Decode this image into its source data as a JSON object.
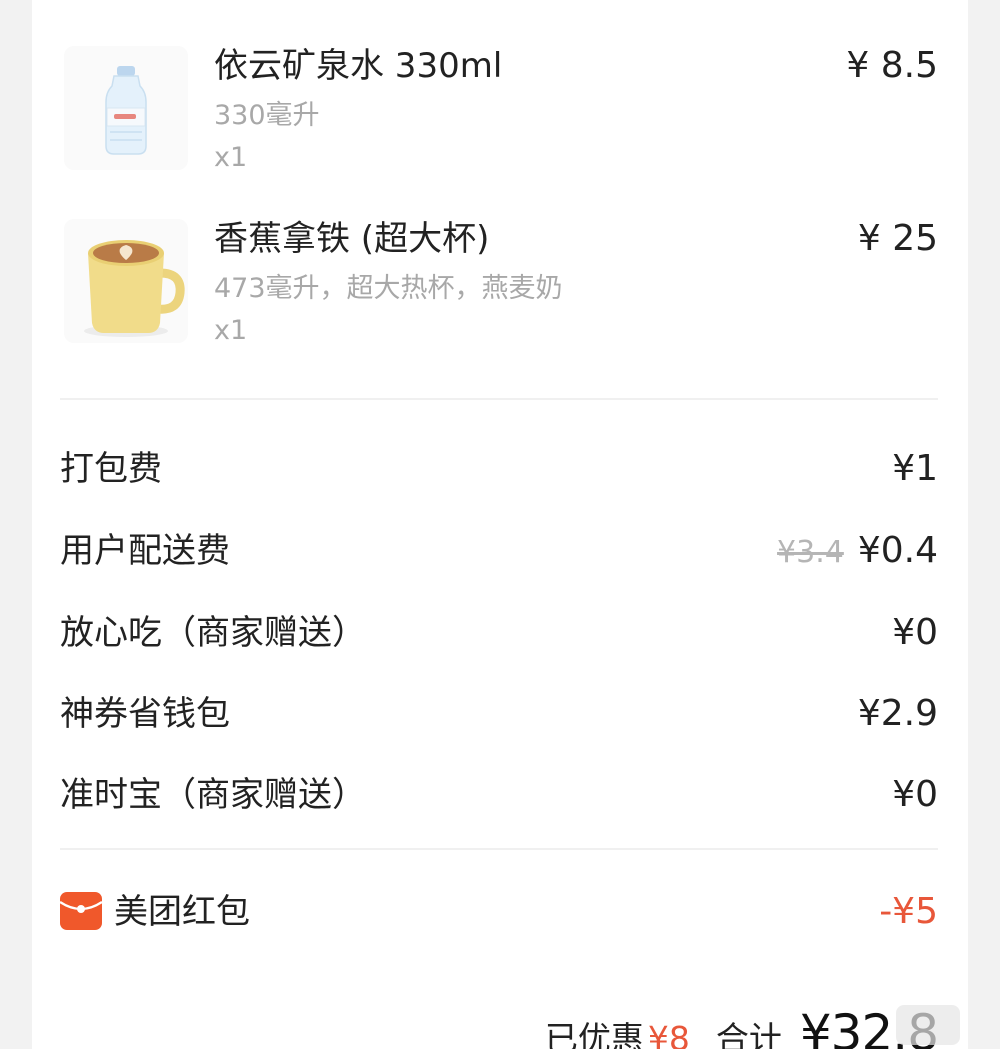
{
  "items": [
    {
      "name": "依云矿泉水 330ml",
      "spec": "330毫升",
      "qty": "x1",
      "price": "¥ 8.5",
      "icon": "water-bottle-icon"
    },
    {
      "name": "香蕉拿铁 (超大杯)",
      "spec": "473毫升，超大热杯，燕麦奶",
      "qty": "x1",
      "price": "¥ 25",
      "icon": "latte-cup-icon"
    }
  ],
  "fees": {
    "packing": {
      "label": "打包费",
      "value": "¥1"
    },
    "delivery": {
      "label": "用户配送费",
      "original": "¥3.4",
      "value": "¥0.4"
    },
    "safe_eat": {
      "label": "放心吃（商家赠送）",
      "value": "¥0"
    },
    "coupon_wallet": {
      "label": "神券省钱包",
      "value": "¥2.9"
    },
    "on_time": {
      "label": "准时宝（商家赠送）",
      "value": "¥0"
    }
  },
  "red_packet": {
    "label": "美团红包",
    "value": "-¥5",
    "icon": "red-packet-icon"
  },
  "summary": {
    "saved_label": "已优惠",
    "saved_value": "¥8",
    "total_label": "合计",
    "total_value": "¥32.8"
  },
  "colors": {
    "accent_red": "#e8573a",
    "muted_text": "#a8a8a8",
    "divider": "#f0f0f0"
  }
}
